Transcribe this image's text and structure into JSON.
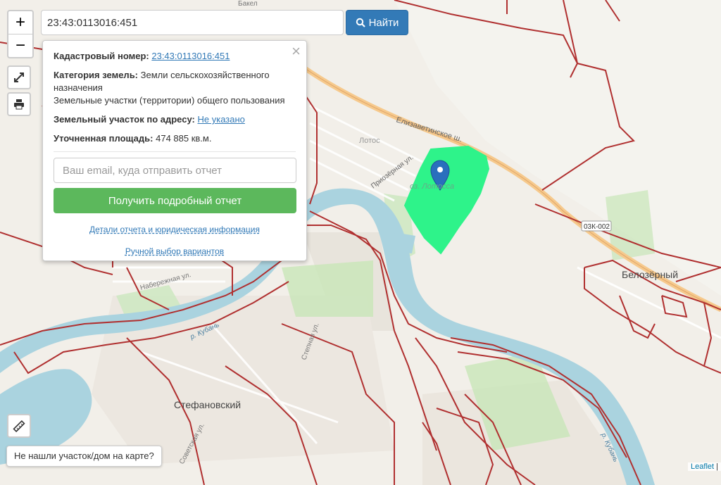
{
  "search": {
    "value": "23:43:0113016:451",
    "button_label": "Найти"
  },
  "zoom": {
    "in_label": "+",
    "out_label": "−"
  },
  "popup": {
    "cadastral_label": "Кадастровый номер:",
    "cadastral_value": "23:43:0113016:451",
    "category_label": "Категория земель:",
    "category_value": "Земли сельскохозяйственного назначения",
    "category_extra": "Земельные участки (территории) общего пользования",
    "address_label": "Земельный участок по адресу:",
    "address_value": "Не указано",
    "area_label": "Уточненная площадь:",
    "area_value": "474 885 кв.м.",
    "email_placeholder": "Ваш email, куда отправить отчет",
    "report_button": "Получить подробный отчет",
    "details_link": "Детали отчета и юридическая информация",
    "manual_link": "Ручной выбор вариантов"
  },
  "not_found": "Не нашли участок/дом на карте?",
  "attribution": "Leaflet",
  "map_labels": {
    "lotos": "Лотос",
    "lake": "оз. Лотосса",
    "elizavetinskoe": "Елизаветинское ш.",
    "priozernaya": "Приозёрная ул.",
    "naberezhnaya": "Набережная ул.",
    "kuban1": "р. Кубань",
    "kuban2": "р. Кубань",
    "stepnaya": "Степная ул.",
    "sovetskaya": "Советская ул.",
    "belozerny": "Белозёрный",
    "stefanovsky": "Стефановский",
    "road_code": "03К-002",
    "bakel": "Бакел"
  },
  "colors": {
    "plot": "#2ef38a",
    "river": "#aad3df",
    "boundary": "#b03030",
    "road": "#f6c98c",
    "marker": "#2a6fbd"
  }
}
